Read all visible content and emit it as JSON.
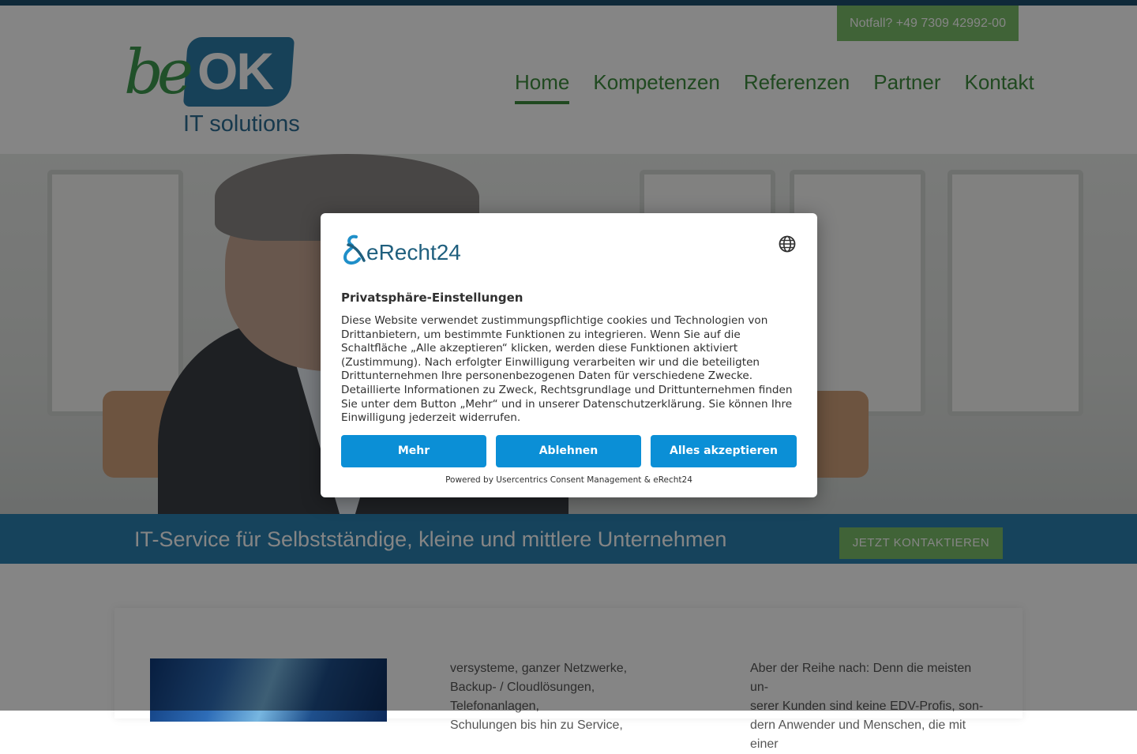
{
  "header": {
    "hotline": "Notfall? +49 7309 42992-00",
    "logo": {
      "script_text": "be",
      "badge_text": "OK",
      "subtitle": "IT solutions"
    },
    "nav": [
      {
        "label": "Home",
        "active": true
      },
      {
        "label": "Kompetenzen",
        "active": false
      },
      {
        "label": "Referenzen",
        "active": false
      },
      {
        "label": "Partner",
        "active": false
      },
      {
        "label": "Kontakt",
        "active": false
      }
    ]
  },
  "banner": {
    "headline": "IT-Service für Selbstständige, kleine und mittlere Unternehmen",
    "cta": "JETZT KONTAKTIEREN"
  },
  "content": {
    "col1_lines": [
      "versysteme, ganzer Netzwerke,",
      "Backup- / Cloudlösungen, Telefonanlagen,",
      "Schulungen bis hin zu Service,"
    ],
    "col2_lines": [
      "Aber der Reihe nach: Denn die meisten un-",
      "serer Kunden sind keine EDV-Profis, son-",
      "dern Anwender und Menschen, die mit einer"
    ]
  },
  "consent": {
    "brand": "eRecht24",
    "title": "Privatsphäre-Einstellungen",
    "body": "Diese Website verwendet zustimmungspflichtige cookies und Technologien von Drittanbietern, um bestimmte Funktionen zu integrieren. Wenn Sie auf die Schaltfläche „Alle akzeptieren“ klicken, werden diese Funktionen aktiviert (Zustimmung). Nach erfolgter Einwilligung verarbeiten wir und die beteiligten Drittunternehmen Ihre personenbezogenen Daten für verschiedene Zwecke. Detaillierte Informationen zu Zweck, Rechtsgrundlage und Drittunternehmen finden Sie unter dem Button „Mehr“ und in unserer Datenschutzerklärung. Sie können Ihre Einwilligung jederzeit widerrufen.",
    "buttons": {
      "more": "Mehr",
      "deny": "Ablehnen",
      "accept_all": "Alles akzeptieren"
    },
    "powered_by": "Powered by Usercentrics Consent Management & eRecht24",
    "icons": {
      "language": "globe-icon",
      "logo_mark": "erecht24-logo-icon"
    }
  },
  "colors": {
    "brand_blue": "#2b81b0",
    "brand_green": "#7cbf6a",
    "nav_green": "#3e8c3f",
    "consent_button": "#0b8fd6",
    "topbar": "#1d4f6e"
  }
}
